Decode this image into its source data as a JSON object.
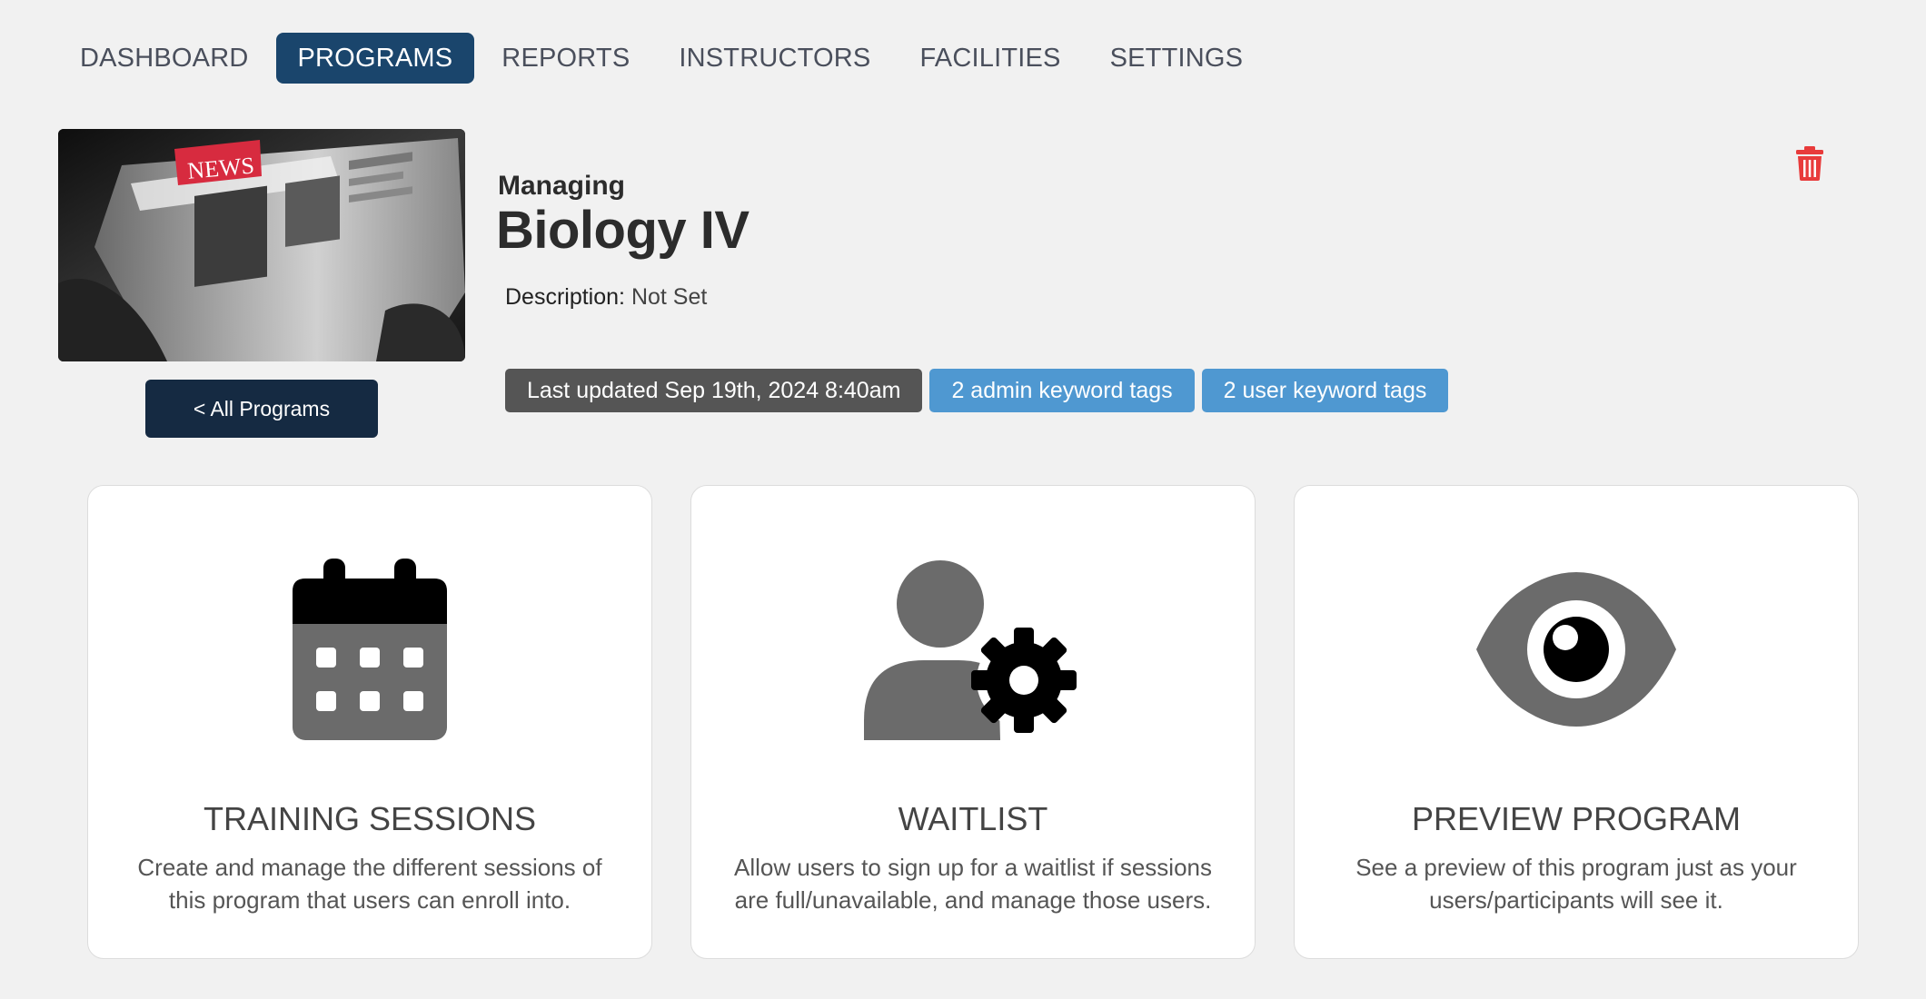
{
  "nav": {
    "items": [
      {
        "label": "DASHBOARD",
        "active": false
      },
      {
        "label": "PROGRAMS",
        "active": true
      },
      {
        "label": "REPORTS",
        "active": false
      },
      {
        "label": "INSTRUCTORS",
        "active": false
      },
      {
        "label": "FACILITIES",
        "active": false
      },
      {
        "label": "SETTINGS",
        "active": false
      }
    ]
  },
  "header": {
    "thumbnail_label": "NEWS",
    "back_button": "< All Programs",
    "managing_label": "Managing",
    "program_title": "Biology IV",
    "description_label": "Description:",
    "description_value": "Not Set",
    "tags": {
      "last_updated": "Last updated Sep 19th, 2024 8:40am",
      "admin_tags": "2 admin keyword tags",
      "user_tags": "2 user keyword tags"
    },
    "delete_icon": "trash-icon"
  },
  "cards": [
    {
      "icon": "calendar-icon",
      "title": "TRAINING SESSIONS",
      "description": "Create and manage the different sessions of this program that users can enroll into."
    },
    {
      "icon": "user-gear-icon",
      "title": "WAITLIST",
      "description": "Allow users to sign up for a waitlist if sessions are full/unavailable, and manage those users."
    },
    {
      "icon": "eye-icon",
      "title": "PREVIEW PROGRAM",
      "description": "See a preview of this program just as your users/participants will see it."
    }
  ],
  "colors": {
    "nav_active": "#1a456c",
    "back_button": "#152a42",
    "tag_dark": "#555555",
    "tag_blue": "#4f98d1",
    "delete": "#e83b3b",
    "background": "#f1f1f1"
  }
}
